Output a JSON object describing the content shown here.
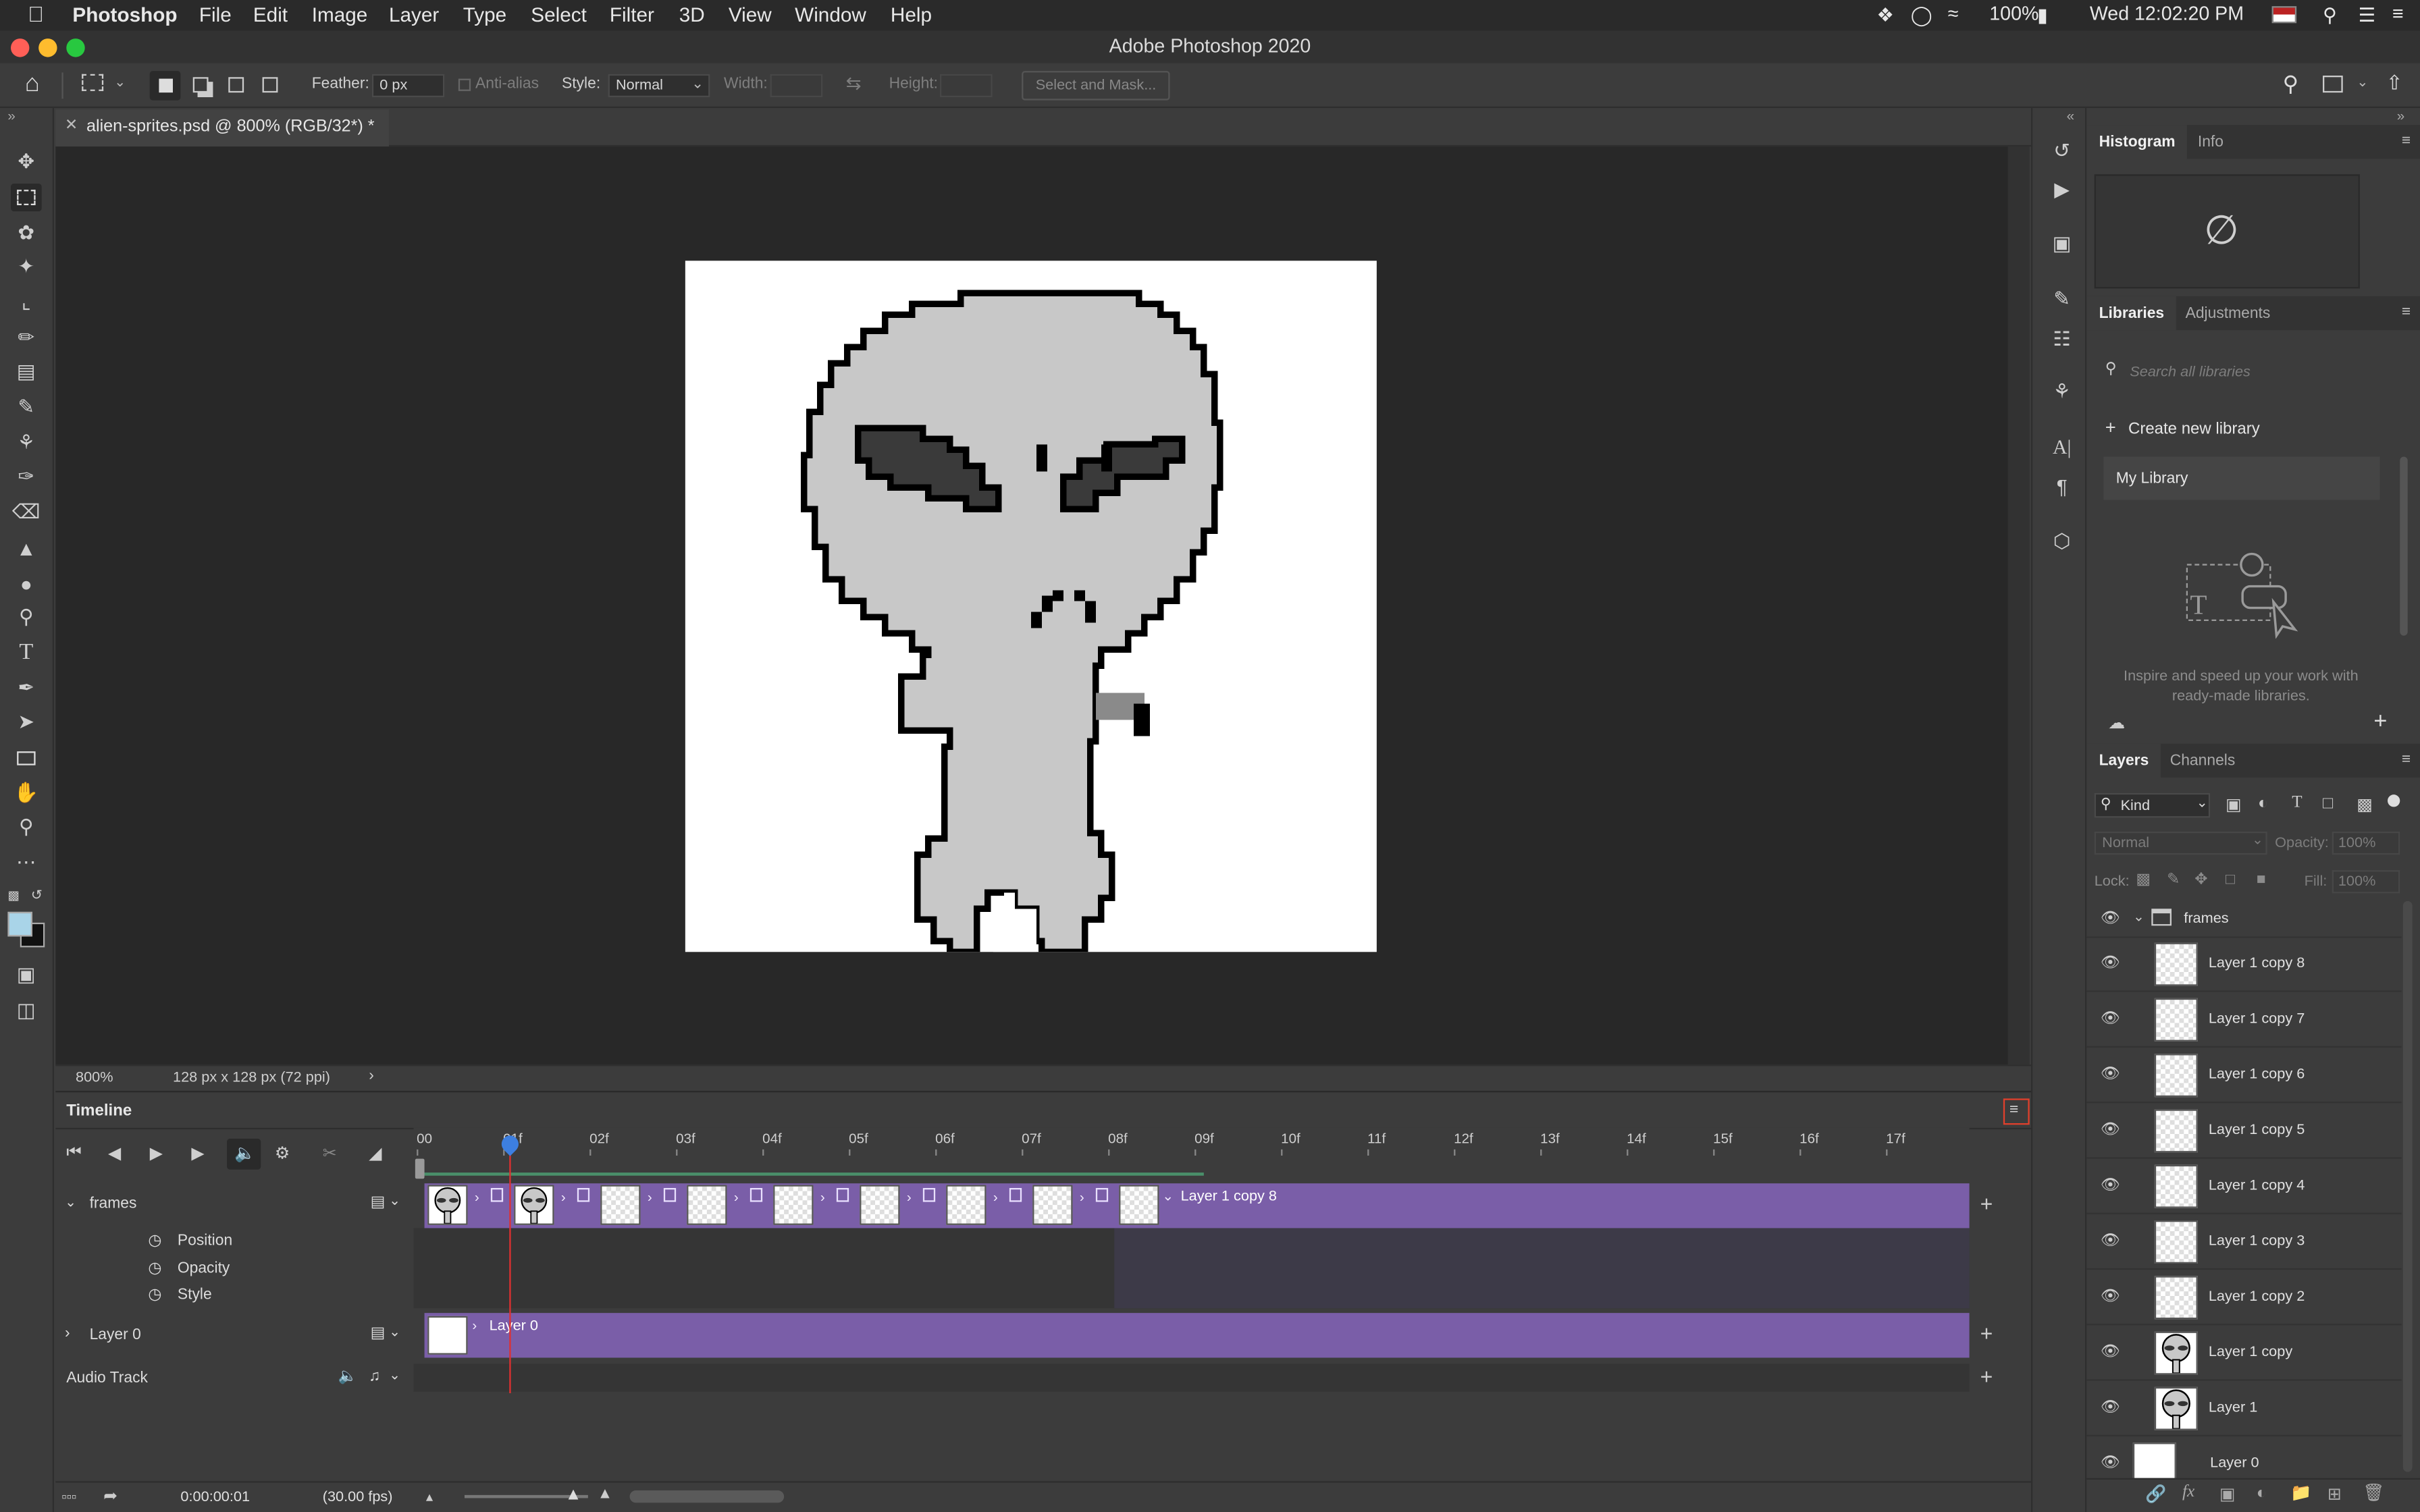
{
  "menubar": {
    "app_name": "Photoshop",
    "items": [
      "File",
      "Edit",
      "Image",
      "Layer",
      "Type",
      "Select",
      "Filter",
      "3D",
      "View",
      "Window",
      "Help"
    ],
    "battery": "100%",
    "clock": "Wed 12:02:20 PM"
  },
  "window": {
    "title": "Adobe Photoshop 2020"
  },
  "options_bar": {
    "feather_label": "Feather:",
    "feather_value": "0 px",
    "antialias_label": "Anti-alias",
    "style_label": "Style:",
    "style_value": "Normal",
    "width_label": "Width:",
    "height_label": "Height:",
    "select_mask_label": "Select and Mask..."
  },
  "document": {
    "tab_title": "alien-sprites.psd @ 800% (RGB/32*) *",
    "zoom": "800%",
    "dimensions": "128 px x 128 px (72 ppi)"
  },
  "timeline": {
    "title": "Timeline",
    "ruler": [
      "00",
      "01f",
      "02f",
      "03f",
      "04f",
      "05f",
      "06f",
      "07f",
      "08f",
      "09f",
      "10f",
      "11f",
      "12f",
      "13f",
      "14f",
      "15f",
      "16f",
      "17f"
    ],
    "frames_track": "frames",
    "clip_label": "Layer 1 copy 8",
    "properties": [
      "Position",
      "Opacity",
      "Style"
    ],
    "layer0_track": "Layer 0",
    "layer0_clip": "Layer 0",
    "audio_track": "Audio Track",
    "timecode": "0:00:00:01",
    "fps": "(30.00 fps)",
    "current_frame": 1,
    "clip_color": "#7a5ea8",
    "playhead_color": "#e03030"
  },
  "panels": {
    "histogram_tabs": [
      "Histogram",
      "Info"
    ],
    "libraries_tabs": [
      "Libraries",
      "Adjustments"
    ],
    "search_placeholder": "Search all libraries",
    "create_library": "Create new library",
    "my_library": "My Library",
    "libraries_promo": "Inspire and speed up your work with ready-made libraries.",
    "layers_tabs": [
      "Layers",
      "Channels"
    ],
    "kind_filter": "Kind",
    "blend_mode": "Normal",
    "opacity_label": "Opacity:",
    "opacity_value": "100%",
    "lock_label": "Lock:",
    "fill_label": "Fill:",
    "fill_value": "100%",
    "group_name": "frames",
    "layers": [
      "Layer 1 copy 8",
      "Layer 1 copy 7",
      "Layer 1 copy 6",
      "Layer 1 copy 5",
      "Layer 1 copy 4",
      "Layer 1 copy 3",
      "Layer 1 copy 2",
      "Layer 1 copy",
      "Layer 1",
      "Layer 0"
    ]
  }
}
